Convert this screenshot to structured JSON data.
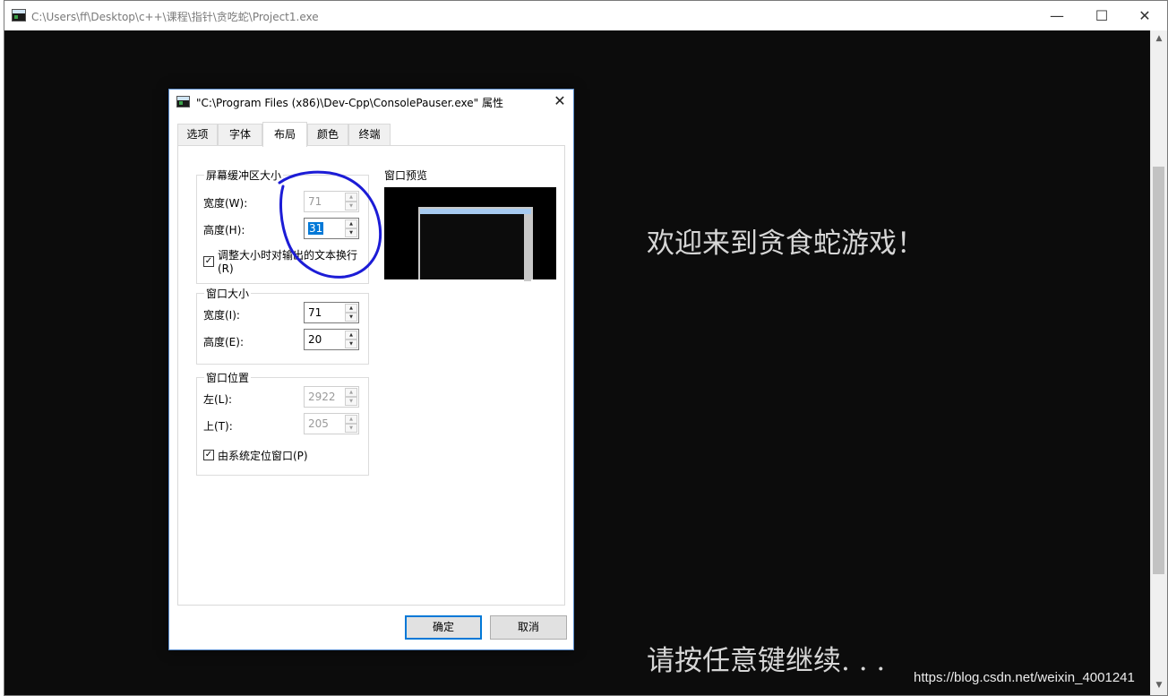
{
  "console": {
    "title": "C:\\Users\\ff\\Desktop\\c++\\课程\\指针\\贪吃蛇\\Project1.exe",
    "welcome": "欢迎来到贪食蛇游戏！",
    "press_key": "请按任意键继续. . .",
    "watermark": "https://blog.csdn.net/weixin_4001241",
    "window_controls": {
      "minimize": "—",
      "maximize": "☐",
      "close": "✕"
    }
  },
  "dialog": {
    "title": "\"C:\\Program Files (x86)\\Dev-Cpp\\ConsolePauser.exe\" 属性",
    "close": "✕",
    "tabs": [
      "选项",
      "字体",
      "布局",
      "颜色",
      "终端"
    ],
    "active_tab": "布局",
    "buffer": {
      "title": "屏幕缓冲区大小",
      "width_label": "宽度(W):",
      "width_value": "71",
      "height_label": "高度(H):",
      "height_value": "31",
      "wrap_label_line1": "调整大小时对输出的文本换行",
      "wrap_label_line2": "(R)",
      "wrap_checked": true
    },
    "window_size": {
      "title": "窗口大小",
      "width_label": "宽度(I):",
      "width_value": "71",
      "height_label": "高度(E):",
      "height_value": "20"
    },
    "window_position": {
      "title": "窗口位置",
      "left_label": "左(L):",
      "left_value": "2922",
      "top_label": "上(T):",
      "top_value": "205",
      "system_label": "由系统定位窗口(P)",
      "system_checked": true
    },
    "preview_label": "窗口预览",
    "ok": "确定",
    "cancel": "取消",
    "check_mark": "✓"
  },
  "annotation_color": "#1c1cd6"
}
